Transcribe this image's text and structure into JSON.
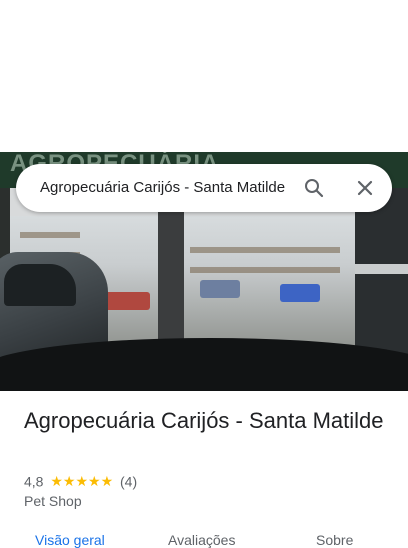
{
  "search": {
    "query": "Agropecuária Carijós - Santa Matilde"
  },
  "photo": {
    "sign_text": "AGROPECUÁRIA"
  },
  "place": {
    "name": "Agropecuária Carijós - Santa Matilde",
    "rating": "4,8",
    "stars": "★★★★★",
    "stars_value": 5,
    "review_count": "(4)",
    "category": "Pet Shop"
  },
  "tabs": [
    {
      "label": "Visão geral",
      "active": true
    },
    {
      "label": "Avaliações",
      "active": false
    },
    {
      "label": "Sobre",
      "active": false
    }
  ],
  "colors": {
    "accent": "#1a73e8",
    "star": "#fbbc04",
    "text_primary": "#202124",
    "text_secondary": "#5f6368"
  },
  "icons": [
    "search-icon",
    "close-icon"
  ]
}
